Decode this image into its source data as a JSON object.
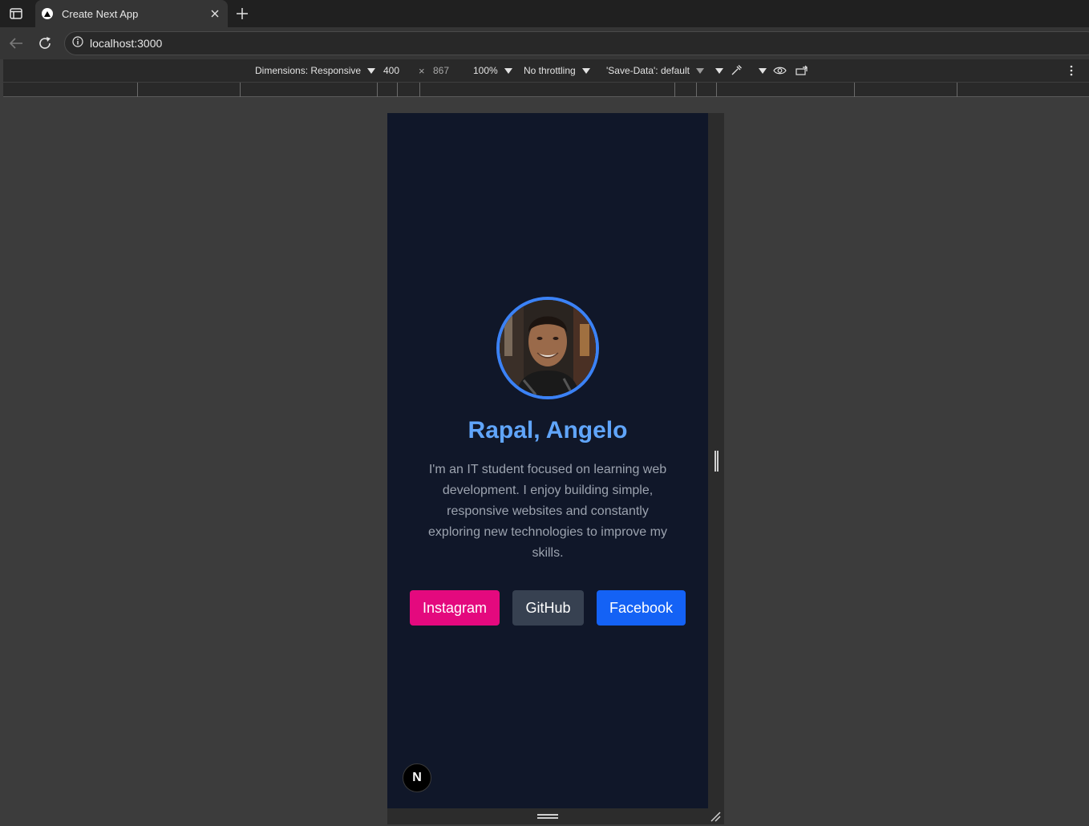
{
  "browser": {
    "tab": {
      "title": "Create Next App"
    },
    "address_bar": {
      "url": "localhost:3000"
    }
  },
  "device_toolbar": {
    "dimensions": "Dimensions: Responsive",
    "width": "400",
    "times": "×",
    "height": "867",
    "zoom": "100%",
    "throttling": "No throttling",
    "save_data": "'Save-Data': default"
  },
  "profile": {
    "name": "Rapal, Angelo",
    "bio": "I'm an IT student focused on learning web development. I enjoy building simple, responsive websites and constantly exploring new technologies to improve my skills.",
    "links": {
      "instagram": "Instagram",
      "github": "GitHub",
      "facebook": "Facebook"
    }
  },
  "next_badge": {
    "letter": "N"
  },
  "colors": {
    "page_bg": "#101729",
    "name": "#60a5fa",
    "avatar_border": "#3b82f6",
    "instagram": "#e4097e",
    "github": "#374151",
    "facebook": "#1462f5"
  }
}
